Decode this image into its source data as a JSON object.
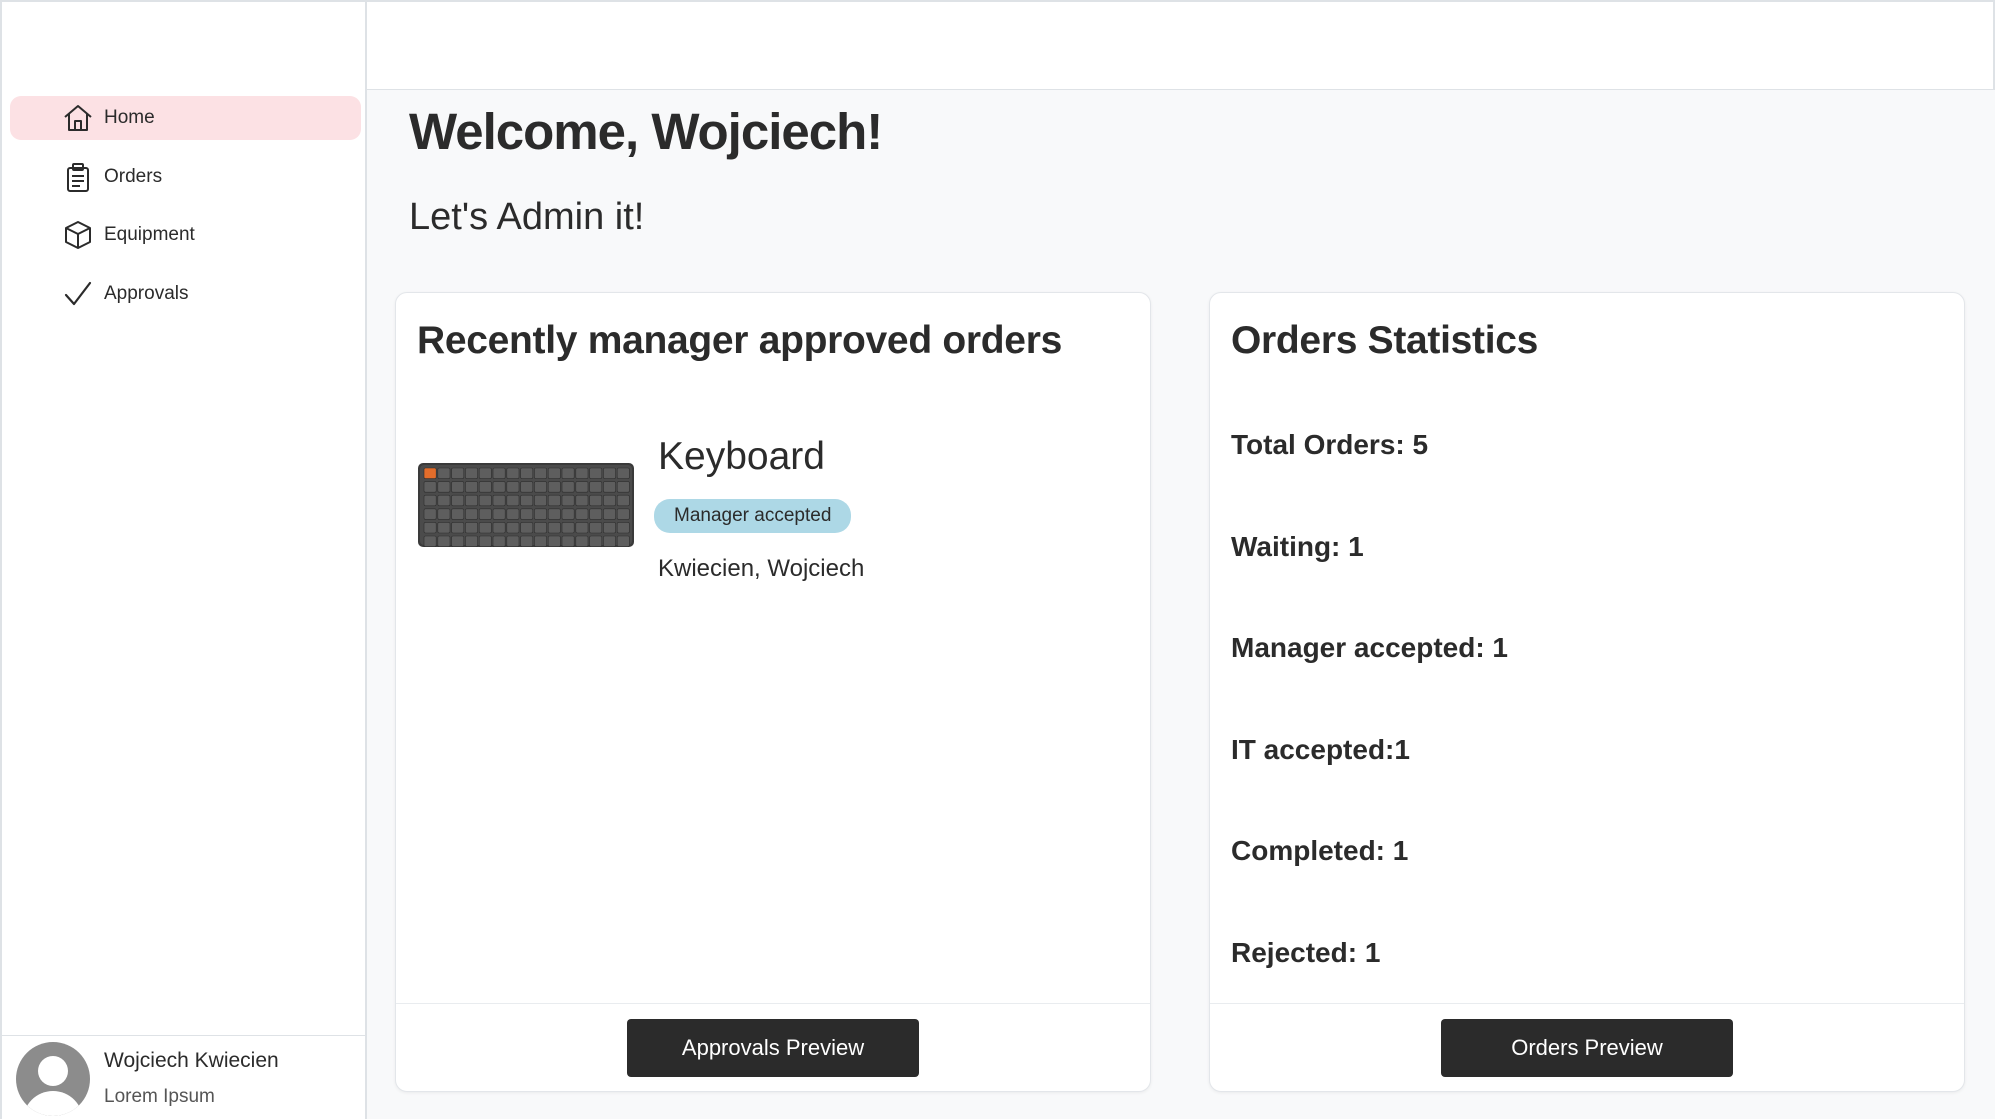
{
  "sidebar": {
    "items": [
      {
        "label": "Home",
        "icon": "home-icon",
        "active": true
      },
      {
        "label": "Orders",
        "icon": "clipboard-icon"
      },
      {
        "label": "Equipment",
        "icon": "box-icon"
      },
      {
        "label": "Approvals",
        "icon": "check-icon"
      }
    ],
    "user": {
      "name": "Wojciech Kwiecien",
      "role": "Lorem Ipsum",
      "icon": "avatar-icon"
    }
  },
  "main": {
    "title": "Welcome, Wojciech!",
    "subtitle": "Let's Admin it!"
  },
  "approved_orders": {
    "title": "Recently manager approved orders",
    "orders": [
      {
        "name": "Keyboard",
        "status": "Manager accepted",
        "person": "Kwiecien, Wojciech",
        "image": "keyboard-image"
      }
    ],
    "button_label": "Approvals Preview"
  },
  "statistics": {
    "title": "Orders Statistics",
    "items": [
      "Total Orders: 5",
      "Waiting: 1",
      "Manager accepted: 1",
      "IT accepted:1",
      "Completed: 1",
      "Rejected: 1"
    ],
    "button_label": "Orders Preview"
  },
  "colors": {
    "active_nav": "#fce1e4",
    "badge": "#add8e6",
    "button": "#2b2b2b",
    "background": "#f8f9fa"
  }
}
